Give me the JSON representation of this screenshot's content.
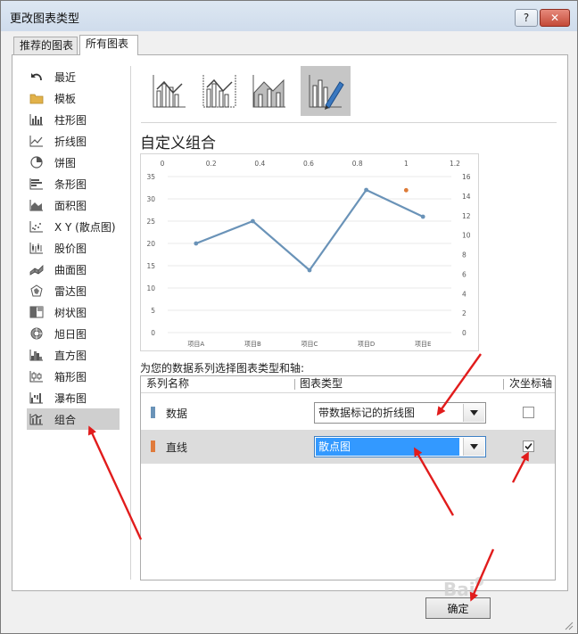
{
  "window": {
    "title": "更改图表类型"
  },
  "tabs": [
    {
      "label": "推荐的图表"
    },
    {
      "label": "所有图表"
    }
  ],
  "chart_types": [
    {
      "label": "最近",
      "icon": "recent-arrow-icon"
    },
    {
      "label": "模板",
      "icon": "folder-icon"
    },
    {
      "label": "柱形图",
      "icon": "column-chart-icon"
    },
    {
      "label": "折线图",
      "icon": "line-chart-icon"
    },
    {
      "label": "饼图",
      "icon": "pie-chart-icon"
    },
    {
      "label": "条形图",
      "icon": "bar-chart-icon"
    },
    {
      "label": "面积图",
      "icon": "area-chart-icon"
    },
    {
      "label": "X Y (散点图)",
      "icon": "scatter-chart-icon"
    },
    {
      "label": "股价图",
      "icon": "stock-chart-icon"
    },
    {
      "label": "曲面图",
      "icon": "surface-chart-icon"
    },
    {
      "label": "雷达图",
      "icon": "radar-chart-icon"
    },
    {
      "label": "树状图",
      "icon": "treemap-chart-icon"
    },
    {
      "label": "旭日图",
      "icon": "sunburst-chart-icon"
    },
    {
      "label": "直方图",
      "icon": "histogram-chart-icon"
    },
    {
      "label": "箱形图",
      "icon": "box-chart-icon"
    },
    {
      "label": "瀑布图",
      "icon": "waterfall-chart-icon"
    },
    {
      "label": "组合",
      "icon": "combo-chart-icon",
      "selected": true
    }
  ],
  "combo_subtypes": [
    {
      "icon": "clustered-column-line-icon"
    },
    {
      "icon": "clustered-column-line-secondary-axis-icon"
    },
    {
      "icon": "stacked-area-clustered-column-icon"
    },
    {
      "icon": "custom-combination-icon",
      "selected": true
    }
  ],
  "section_title": "自定义组合",
  "chart_data": {
    "type": "line",
    "categories": [
      "项目A",
      "项目B",
      "项目C",
      "项目D",
      "项目E"
    ],
    "series": [
      {
        "values": [
          20,
          25,
          14,
          32,
          26
        ],
        "color": "#6a93b8"
      },
      {
        "type": "scatter",
        "points": [
          {
            "x": 1,
            "y": 14.6
          }
        ],
        "color": "#dd7b38"
      }
    ],
    "y_left": {
      "ticks": [
        "0",
        "5",
        "10",
        "15",
        "20",
        "25",
        "30",
        "35"
      ],
      "lim": [
        0,
        35
      ]
    },
    "y_right": {
      "ticks": [
        "0",
        "2",
        "4",
        "6",
        "8",
        "10",
        "12",
        "14",
        "16"
      ],
      "lim": [
        0,
        16
      ]
    },
    "x_top": {
      "ticks": [
        "0",
        "0.2",
        "0.4",
        "0.6",
        "0.8",
        "1",
        "1.2"
      ],
      "lim": [
        0,
        1.2
      ]
    },
    "grid": true,
    "legend": "none"
  },
  "series_panel": {
    "caption": "为您的数据系列选择图表类型和轴:",
    "headers": {
      "name": "系列名称",
      "type": "图表类型",
      "axis": "次坐标轴"
    },
    "rows": [
      {
        "name": "数据",
        "swatch": "#6a93b8",
        "chart_type": "带数据标记的折线图",
        "secondary_axis": false
      },
      {
        "name": "直线",
        "swatch": "#e07b3c",
        "chart_type": "散点图",
        "secondary_axis": true
      }
    ]
  },
  "footer": {
    "ok_label": "确定"
  },
  "colors": {
    "arrow": "#e11c1c",
    "accent": "#3399ff",
    "selected_bg": "#cfcfcf"
  }
}
